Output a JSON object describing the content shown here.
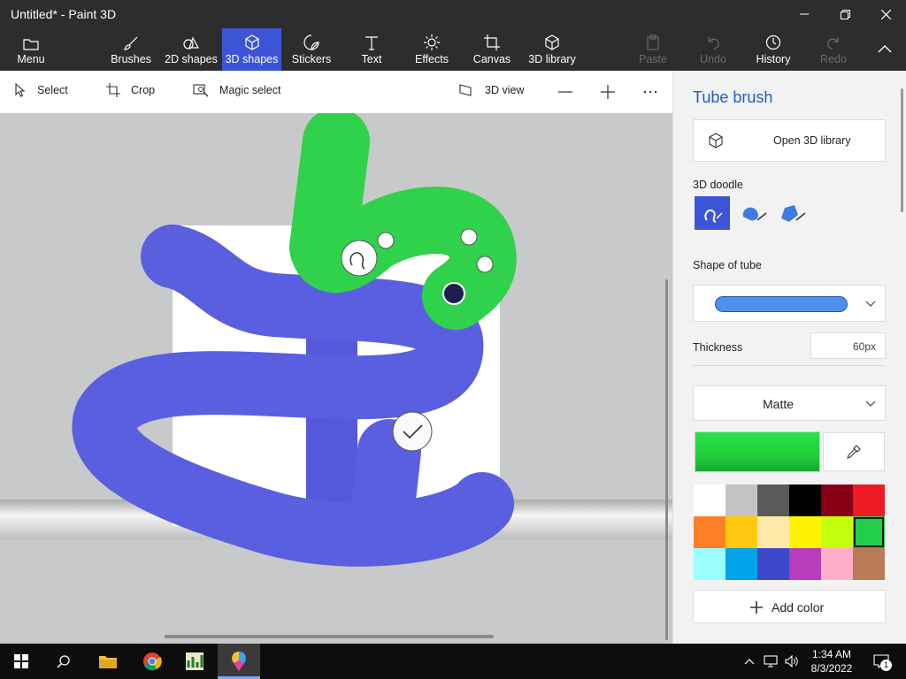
{
  "window": {
    "title": "Untitled* - Paint 3D"
  },
  "ribbon": {
    "menu": "Menu",
    "tabs": [
      "Brushes",
      "2D shapes",
      "3D shapes",
      "Stickers",
      "Text",
      "Effects",
      "Canvas",
      "3D library"
    ],
    "active_tab": "3D shapes",
    "paste": "Paste",
    "undo": "Undo",
    "history": "History",
    "redo": "Redo"
  },
  "toolbar": {
    "select": "Select",
    "crop": "Crop",
    "magic_select": "Magic select",
    "view_3d": "3D view"
  },
  "panel": {
    "title": "Tube brush",
    "open_library": "Open 3D library",
    "doodle_label": "3D doodle",
    "shape_label": "Shape of tube",
    "thickness_label": "Thickness",
    "thickness_value": "60px",
    "finish": "Matte",
    "add_color": "Add color",
    "current_color": "#1fcf3a",
    "palette": [
      "#ffffff",
      "#c3c3c3",
      "#5a5a5a",
      "#000000",
      "#880015",
      "#ed1c24",
      "#ff7f27",
      "#ffc90e",
      "#ffe9a8",
      "#fff200",
      "#c4ff0e",
      "#22cf4b",
      "#99ffff",
      "#00a2e8",
      "#3f48cc",
      "#b83dba",
      "#ffaec9",
      "#b97a57"
    ],
    "selected_swatch": 11
  },
  "taskbar": {
    "time": "1:34 AM",
    "date": "8/3/2022",
    "notification_count": "1"
  }
}
